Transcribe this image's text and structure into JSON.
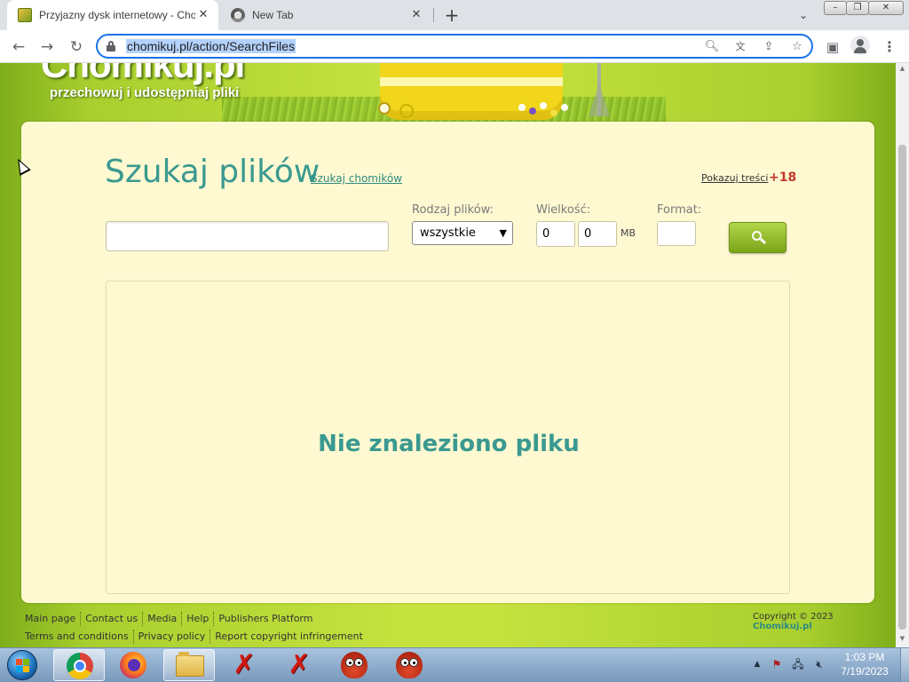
{
  "browser": {
    "tabs": [
      {
        "title": "Przyjazny dysk internetowy - Cho",
        "close": "✕"
      },
      {
        "title": "New Tab",
        "close": "✕"
      }
    ],
    "new_tab": "+",
    "tab_menu": "⌄",
    "window_buttons": {
      "minimize": "–",
      "maximize": "❐",
      "close": "✕"
    },
    "nav": {
      "back": "←",
      "forward": "→",
      "reload": "↻"
    },
    "url": "chomikuj.pl/action/SearchFiles",
    "omnibox_icons": [
      "search-icon",
      "translate-icon",
      "share-icon",
      "star-icon"
    ],
    "toolbar_icons": [
      "side-panel-icon",
      "profile-avatar-icon",
      "menu-icon"
    ]
  },
  "header": {
    "logo_text": "Chomikuj.pl",
    "tagline": "przechowuj i udostępniaj pliki"
  },
  "search": {
    "title": "Szukaj plików",
    "search_chomiki_link": "Szukaj chomików",
    "adult_link": "Pokazuj treści",
    "adult_badge": "+18",
    "query_value": "",
    "file_type_label": "Rodzaj plików:",
    "file_type_selected": "wszystkie",
    "size_label": "Wielkość:",
    "size_min": "0",
    "size_max": "0",
    "size_unit": "MB",
    "format_label": "Format:",
    "format_value": ""
  },
  "results": {
    "message": "Nie znaleziono pliku"
  },
  "footer": {
    "row1": [
      "Main page",
      "Contact us",
      "Media",
      "Help",
      "Publishers Platform"
    ],
    "row2": [
      "Terms and conditions",
      "Privacy policy",
      "Report copyright infringement"
    ],
    "copyright": "Copyright © 2023",
    "copyright_brand": "Chomikuj.pl"
  },
  "taskbar": {
    "apps": [
      "chrome-icon",
      "firefox-icon",
      "file-explorer-icon",
      "red-x-app-icon",
      "red-x-app-icon",
      "owl-app-icon",
      "owl-app-icon"
    ],
    "clock_time": "1:03 PM",
    "clock_date": "7/19/2023"
  }
}
